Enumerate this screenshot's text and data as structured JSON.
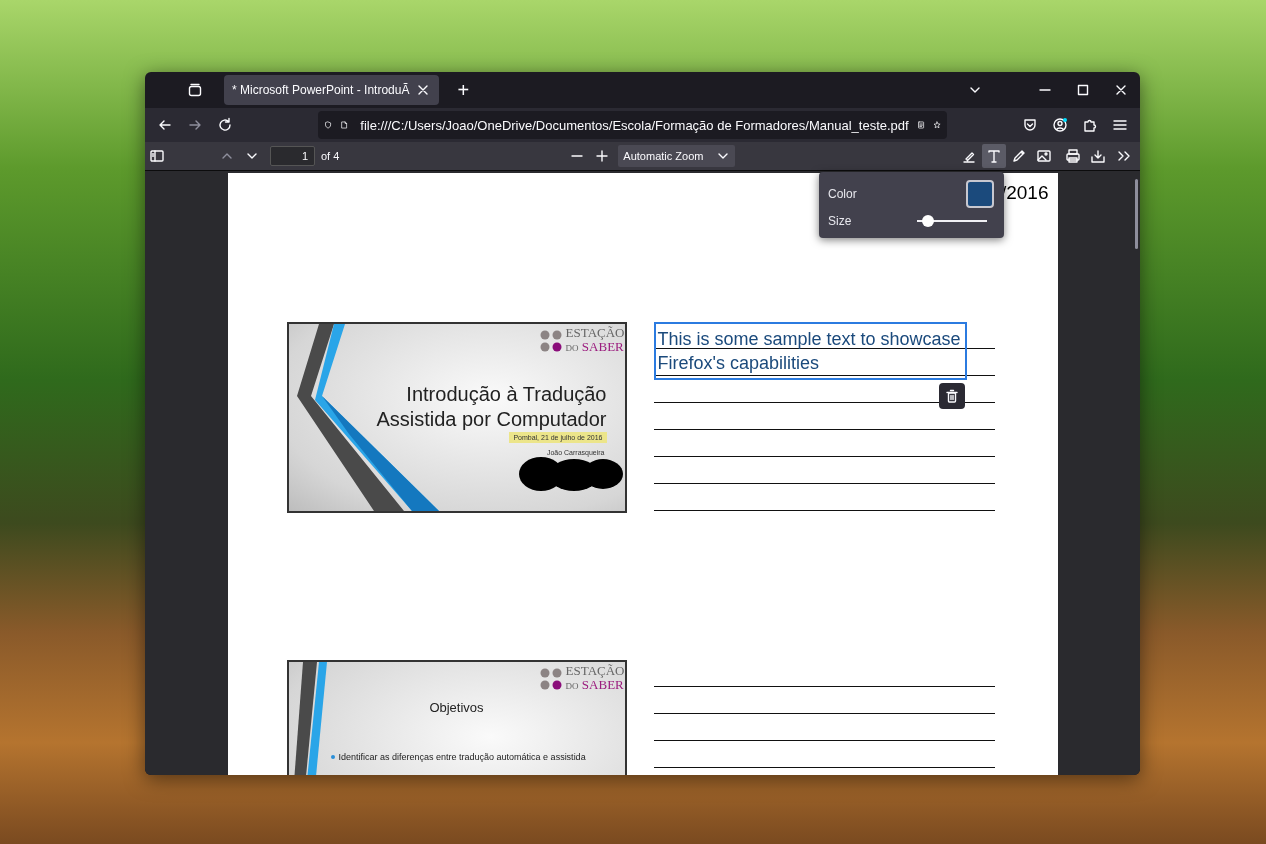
{
  "window": {
    "tab": {
      "title": "* Microsoft PowerPoint - IntroduÃ",
      "selected": true
    },
    "new_tab": "+",
    "url": "file:///C:/Users/Joao/OneDrive/Documentos/Escola/Formação de Formadores/Manual_teste.pdf"
  },
  "pdf_toolbar": {
    "page": "1",
    "page_count": "of 4",
    "zoom": "Automatic Zoom",
    "tools": [
      {
        "kind": "highlight",
        "selected": false
      },
      {
        "kind": "text",
        "selected": true
      },
      {
        "kind": "draw",
        "selected": false
      },
      {
        "kind": "image",
        "selected": false
      }
    ]
  },
  "text_popup": {
    "color_label": "Color",
    "color": "#1b4a7c",
    "size_label": "Size",
    "level": 0.15
  },
  "document": {
    "header_fragment": "/2016",
    "slides": [
      {
        "kind": "title",
        "logo_top": "ESTAÇÃO",
        "logo_prefix": "DO",
        "logo_name": "SABER",
        "title": "Introdução à Tradução Assistida por Computador",
        "date": "Pombal, 21 de julho de 2016",
        "author": "João Carrasqueira"
      },
      {
        "kind": "bullets",
        "logo_top": "ESTAÇÃO",
        "logo_prefix": "DO",
        "logo_name": "SABER",
        "title": "Objetivos",
        "bullets": [
          "Identificar as diferenças entre tradução automática e assistida"
        ]
      }
    ],
    "annotation": {
      "text": "This is some sample text to showcase Firefox's capabilities",
      "selected": true
    }
  }
}
